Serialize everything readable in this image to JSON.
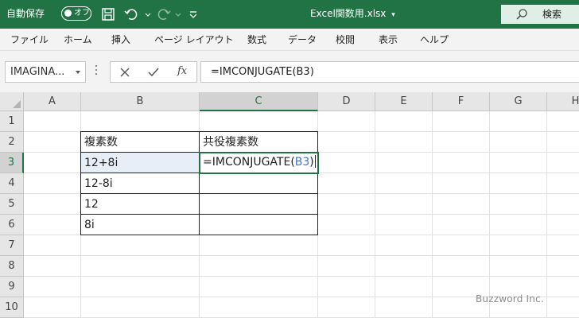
{
  "titlebar": {
    "autosave_label": "自動保存",
    "autosave_state": "オフ",
    "filename": "Excel関数用.xlsx",
    "search_label": "検索",
    "colors": {
      "bar": "#217346",
      "search_bg": "#dfeee6"
    }
  },
  "quick_access_icons": [
    "save-icon",
    "undo-icon",
    "redo-icon",
    "customize-icon"
  ],
  "ribbon": {
    "tabs": [
      "ファイル",
      "ホーム",
      "挿入",
      "ページ レイアウト",
      "数式",
      "データ",
      "校閲",
      "表示",
      "ヘルプ"
    ]
  },
  "formula_bar": {
    "name_box": "IMAGINA...",
    "formula": "=IMCONJUGATE(B3)",
    "fx_label": "fx"
  },
  "grid": {
    "column_headers": [
      "A",
      "B",
      "C",
      "D",
      "E",
      "F",
      "G",
      "H"
    ],
    "selected_column": "C",
    "row_headers": [
      "1",
      "2",
      "3",
      "4",
      "5",
      "6",
      "7",
      "8",
      "9",
      "10"
    ],
    "selected_row": "3",
    "cells": {
      "B2": "複素数",
      "C2": "共役複素数",
      "B3": "12+8i",
      "B4": "12-8i",
      "B5": "12",
      "B6": "8i"
    },
    "editing": {
      "cell": "C3",
      "prefix": "=IMCONJUGATE(",
      "reference": "B3",
      "suffix": ")"
    },
    "colors": {
      "active": "#217346",
      "reference": "#4472c4",
      "reference_fill": "#e8eef8"
    }
  },
  "watermark": "Buzzword Inc."
}
